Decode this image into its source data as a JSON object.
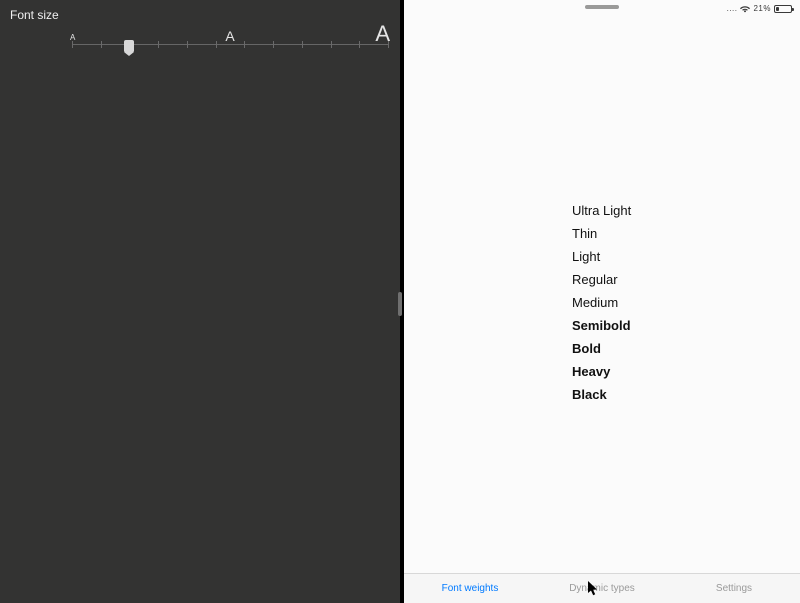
{
  "left": {
    "title": "Font size",
    "slider": {
      "ticks": 12,
      "value_index": 2,
      "letters": [
        "A",
        "A",
        "A"
      ]
    }
  },
  "status": {
    "cellular_dots": "....",
    "battery_pct": "21%"
  },
  "weights": [
    {
      "label": "Ultra Light",
      "weight": 100
    },
    {
      "label": "Thin",
      "weight": 200
    },
    {
      "label": "Light",
      "weight": 300
    },
    {
      "label": "Regular",
      "weight": 400
    },
    {
      "label": "Medium",
      "weight": 500
    },
    {
      "label": "Semibold",
      "weight": 600
    },
    {
      "label": "Bold",
      "weight": 700
    },
    {
      "label": "Heavy",
      "weight": 800
    },
    {
      "label": "Black",
      "weight": 900
    }
  ],
  "tabs": [
    {
      "label": "Font weights",
      "active": true
    },
    {
      "label": "Dynamic types",
      "active": false
    },
    {
      "label": "Settings",
      "active": false
    }
  ]
}
